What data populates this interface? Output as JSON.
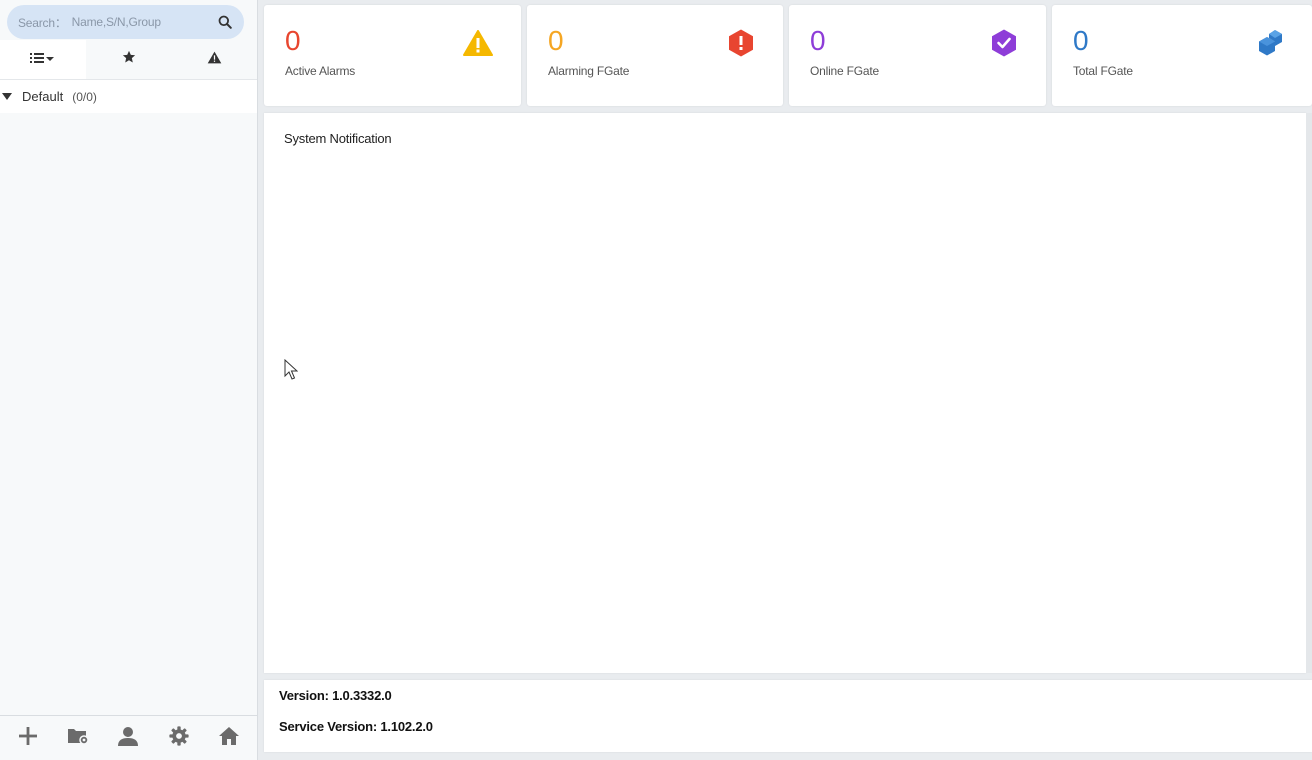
{
  "sidebar": {
    "search": {
      "label": "Search：",
      "placeholder": "Name,S/N,Group"
    },
    "tabs": [
      {
        "name": "list-view",
        "icon": "list-dropdown-icon",
        "active": true
      },
      {
        "name": "favorites",
        "icon": "star-icon",
        "active": false
      },
      {
        "name": "alarms",
        "icon": "warning-icon",
        "active": false
      }
    ],
    "tree": {
      "group_label": "Default",
      "group_count": "(0/0)"
    },
    "bottom_actions": [
      "add-icon",
      "folder-settings-icon",
      "user-icon",
      "gear-icon",
      "home-icon"
    ]
  },
  "cards": [
    {
      "value": "0",
      "label": "Active Alarms",
      "color": "#e8462f",
      "icon": "warning-triangle-icon",
      "icon_color": "#f5b800"
    },
    {
      "value": "0",
      "label": "Alarming FGate",
      "color": "#f5a623",
      "icon": "alert-hexagon-icon",
      "icon_color": "#e84530"
    },
    {
      "value": "0",
      "label": "Online FGate",
      "color": "#8e3dd8",
      "icon": "check-hexagon-icon",
      "icon_color": "#8e3dd8"
    },
    {
      "value": "0",
      "label": "Total FGate",
      "color": "#2f79c7",
      "icon": "cubes-icon",
      "icon_color": "#2f79c7"
    }
  ],
  "notification": {
    "title": "System Notification"
  },
  "version": {
    "app_version": "Version: 1.0.3332.0",
    "service_version": "Service Version: 1.102.2.0"
  }
}
